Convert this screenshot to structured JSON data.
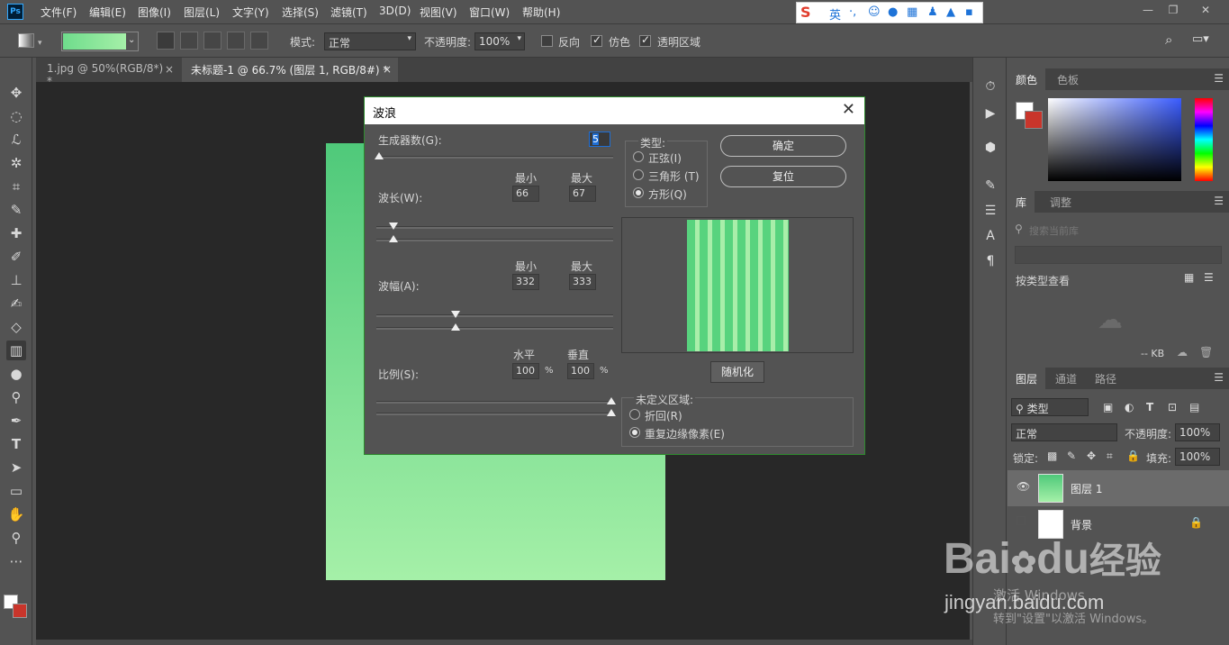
{
  "menubar": {
    "logo": "Ps",
    "items": [
      "文件(F)",
      "编辑(E)",
      "图像(I)",
      "图层(L)",
      "文字(Y)",
      "选择(S)",
      "滤镜(T)",
      "3D(D)",
      "视图(V)",
      "窗口(W)",
      "帮助(H)"
    ],
    "ime_label": "英"
  },
  "options": {
    "mode_label": "模式:",
    "mode_value": "正常",
    "opacity_label": "不透明度:",
    "opacity_value": "100%",
    "reverse_label": "反向",
    "dither_label": "仿色",
    "transparency_label": "透明区域",
    "gradient_colors": [
      "#6fdc8c",
      "#a5f0a8"
    ]
  },
  "tabs": [
    {
      "label": "1.jpg @ 50%(RGB/8*) *"
    },
    {
      "label": "未标题-1 @ 66.7% (图层 1, RGB/8#) *"
    }
  ],
  "dialog": {
    "title": "波浪",
    "generators_label": "生成器数(G):",
    "generators_value": "5",
    "wavelength_label": "波长(W):",
    "amplitude_label": "波幅(A):",
    "scale_label": "比例(S):",
    "min_label": "最小",
    "max_label": "最大",
    "horizontal_label": "水平",
    "vertical_label": "垂直",
    "percent": "%",
    "wavelength_min": "66",
    "wavelength_max": "67",
    "amplitude_min": "332",
    "amplitude_max": "333",
    "scale_h": "100",
    "scale_v": "100",
    "type_label": "类型:",
    "type_sine": "正弦(I)",
    "type_triangle": "三角形 (T)",
    "type_square": "方形(Q)",
    "ok": "确定",
    "reset": "复位",
    "randomize": "随机化",
    "undefined_label": "未定义区域:",
    "wrap_label": "折回(R)",
    "repeat_label": "重复边缘像素(E)"
  },
  "panels": {
    "color_tab": "颜色",
    "swatches_tab": "色板",
    "library_tab": "库",
    "adjust_tab": "调整",
    "search_placeholder": "搜索当前库",
    "view_by_type": "按类型查看",
    "kb_label": "-- KB",
    "layers_tab": "图层",
    "channels_tab": "通道",
    "paths_tab": "路径",
    "kind_label": "类型",
    "blend_mode": "正常",
    "opacity_label": "不透明度:",
    "opacity_value": "100%",
    "lock_label": "锁定:",
    "fill_label": "填充:",
    "fill_value": "100%",
    "layers": [
      {
        "name": "图层 1"
      },
      {
        "name": "背景"
      }
    ]
  },
  "watermark": {
    "baidu": "Bai",
    "du": "du",
    "jingyan_cn": "经验",
    "url": "jingyan.baidu.com",
    "activate": "激活 Windows",
    "activate_sub": "转到\"设置\"以激活 Windows。"
  }
}
